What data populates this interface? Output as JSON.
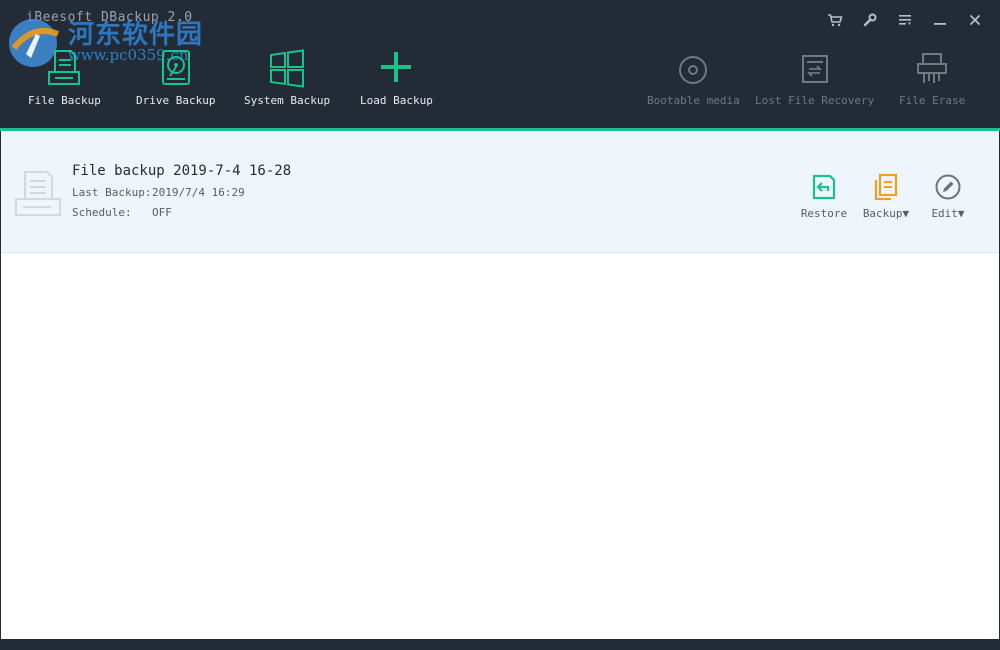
{
  "window": {
    "title": "iBeesoft DBackup 2.0",
    "watermark_text": "河东软件园",
    "watermark_url": "www.pc0359.cn"
  },
  "toolbar": {
    "file_backup": "File Backup",
    "drive_backup": "Drive Backup",
    "system_backup": "System Backup",
    "load_backup": "Load Backup",
    "bootable_media": "Bootable media",
    "lost_file_recovery": "Lost File Recovery",
    "file_erase": "File Erase"
  },
  "task": {
    "name": "File backup 2019-7-4 16-28",
    "last_backup_label": "Last Backup:",
    "last_backup_value": "2019/7/4 16:29",
    "schedule_label": "Schedule:",
    "schedule_value": "OFF",
    "restore": "Restore",
    "backup": "Backup▼",
    "edit": "Edit▼"
  },
  "colors": {
    "accent": "#17c48b",
    "toolbar_bg": "#222b36",
    "backup_orange": "#f0a020",
    "row_bg": "#eef6fc"
  },
  "icons": [
    "cart-icon",
    "wrench-icon",
    "menu-icon",
    "minimize-icon",
    "close-icon",
    "file-icon",
    "drive-icon",
    "windows-icon",
    "plus-icon",
    "disc-icon",
    "recovery-icon",
    "shredder-icon",
    "restore-icon",
    "backup-icon",
    "edit-icon"
  ]
}
